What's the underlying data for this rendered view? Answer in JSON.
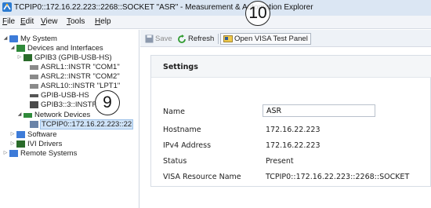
{
  "window": {
    "title": "TCPIP0::172.16.22.223::2268::SOCKET \"ASR\" - Measurement & Automation Explorer",
    "app_icon": "mae-app-icon"
  },
  "menu": [
    {
      "key": "F",
      "rest": "ile"
    },
    {
      "key": "E",
      "rest": "dit"
    },
    {
      "key": "V",
      "rest": "iew"
    },
    {
      "key": "T",
      "rest": "ools"
    },
    {
      "key": "H",
      "rest": "elp"
    }
  ],
  "tree": [
    {
      "label": "My System",
      "twisty": "◢",
      "icon": "computer-icon",
      "color": "#3d7bd8"
    },
    {
      "label": "Devices and Interfaces",
      "twisty": "◢",
      "icon": "devices-icon",
      "color": "#2f8a3a"
    },
    {
      "label": "GPIB3 (GPIB-USB-HS)",
      "twisty": "▷",
      "icon": "gpib-card-icon",
      "color": "#2a6b2a"
    },
    {
      "label": "ASRL1::INSTR \"COM1\"",
      "twisty": "",
      "icon": "serial-port-icon",
      "color": "#6e6e6e"
    },
    {
      "label": "ASRL2::INSTR \"COM2\"",
      "twisty": "",
      "icon": "serial-port-icon",
      "color": "#6e6e6e"
    },
    {
      "label": "ASRL10::INSTR \"LPT1\"",
      "twisty": "",
      "icon": "serial-port-icon",
      "color": "#6e6e6e"
    },
    {
      "label": "GPIB-USB-HS",
      "twisty": "",
      "icon": "usb-icon",
      "color": "#555555"
    },
    {
      "label": "GPIB3::3::INSTR",
      "twisty": "",
      "icon": "instrument-icon",
      "color": "#4a4a4a"
    },
    {
      "label": "Network Devices",
      "twisty": "◢",
      "icon": "network-icon",
      "color": "#2f8a3a"
    },
    {
      "label": "TCPIP0::172.16.22.223::22",
      "twisty": "",
      "icon": "network-device-icon",
      "color": "#6b84a8"
    },
    {
      "label": "Software",
      "twisty": "▷",
      "icon": "software-icon",
      "color": "#3d7bd8"
    },
    {
      "label": "IVI Drivers",
      "twisty": "▷",
      "icon": "ivi-drivers-icon",
      "color": "#2a6b2a"
    },
    {
      "label": "Remote Systems",
      "twisty": "▷",
      "icon": "remote-systems-icon",
      "color": "#3d7bd8"
    }
  ],
  "toolbar": {
    "save": "Save",
    "refresh": "Refresh",
    "open_visa": "Open VISA Test Panel"
  },
  "settings": {
    "heading": "Settings",
    "name_label": "Name",
    "name_value": "ASR",
    "hostname_label": "Hostname",
    "hostname_value": "172.16.22.223",
    "ipv4_label": "IPv4 Address",
    "ipv4_value": "172.16.22.223",
    "status_label": "Status",
    "status_value": "Present",
    "visa_label": "VISA Resource Name",
    "visa_value": "TCPIP0::172.16.22.223::2268::SOCKET"
  },
  "callouts": {
    "c10": "10",
    "c9": "9"
  }
}
